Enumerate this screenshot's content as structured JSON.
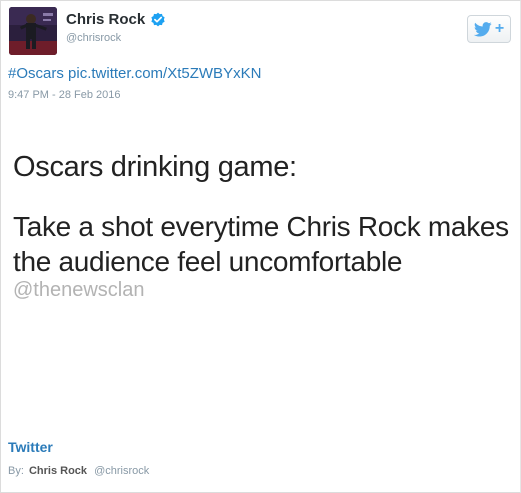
{
  "author": {
    "name": "Chris Rock",
    "handle": "@chrisrock"
  },
  "follow_button": {
    "icon": "twitter-bird-icon",
    "plus": "+"
  },
  "tweet": {
    "hashtag": "#Oscars",
    "link": "pic.twitter.com/Xt5ZWBYxKN",
    "timestamp": "9:47 PM - 28 Feb 2016"
  },
  "media": {
    "line1": "Oscars drinking game:",
    "line2": "Take a shot everytime Chris Rock makes",
    "line3": "the audience feel uncomfortable",
    "watermark": "@thenewsclan"
  },
  "footer": {
    "source": "Twitter",
    "by_label": "By:",
    "by_name": "Chris Rock",
    "by_handle": "@chrisrock"
  },
  "colors": {
    "link": "#2b7bb9",
    "twitter_blue": "#55acee",
    "verified": "#1da1f2",
    "muted": "#8899a6"
  }
}
